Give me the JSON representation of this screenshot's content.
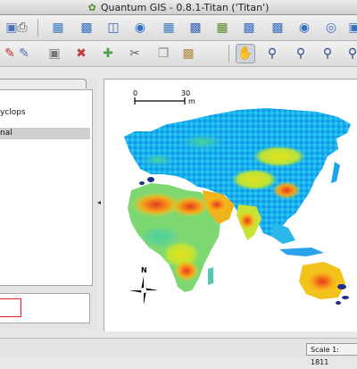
{
  "window": {
    "title": "Quantum GIS - 0.8.1-Titan ('Titan')"
  },
  "toolbar_top": {
    "icons": [
      "save-project-icon",
      "print-icon",
      "new-vector-layer-icon",
      "add-raster-layer-icon",
      "add-postgis-layer-icon",
      "add-wms-layer-icon",
      "database-icon",
      "grass-icon",
      "globe-icon",
      "map-composer-icon",
      "plugin-icon",
      "capture-icon"
    ]
  },
  "toolbar_bottom": {
    "icons": [
      "digitize-icon",
      "edit-icon",
      "stop-edit-icon",
      "delete-icon",
      "move-feature-icon",
      "cut-icon",
      "copy-icon",
      "paste-icon",
      "pan-icon",
      "zoom-in-icon",
      "zoom-out-icon",
      "zoom-full-icon"
    ]
  },
  "legend": {
    "items": [
      {
        "label": "yclops"
      },
      {
        "label": "nal"
      }
    ]
  },
  "map": {
    "scalebar_labels": [
      "0",
      "30"
    ],
    "scalebar_unit": "m",
    "north_label": "N"
  },
  "status": {
    "scale": "Scale 1: 1811"
  }
}
